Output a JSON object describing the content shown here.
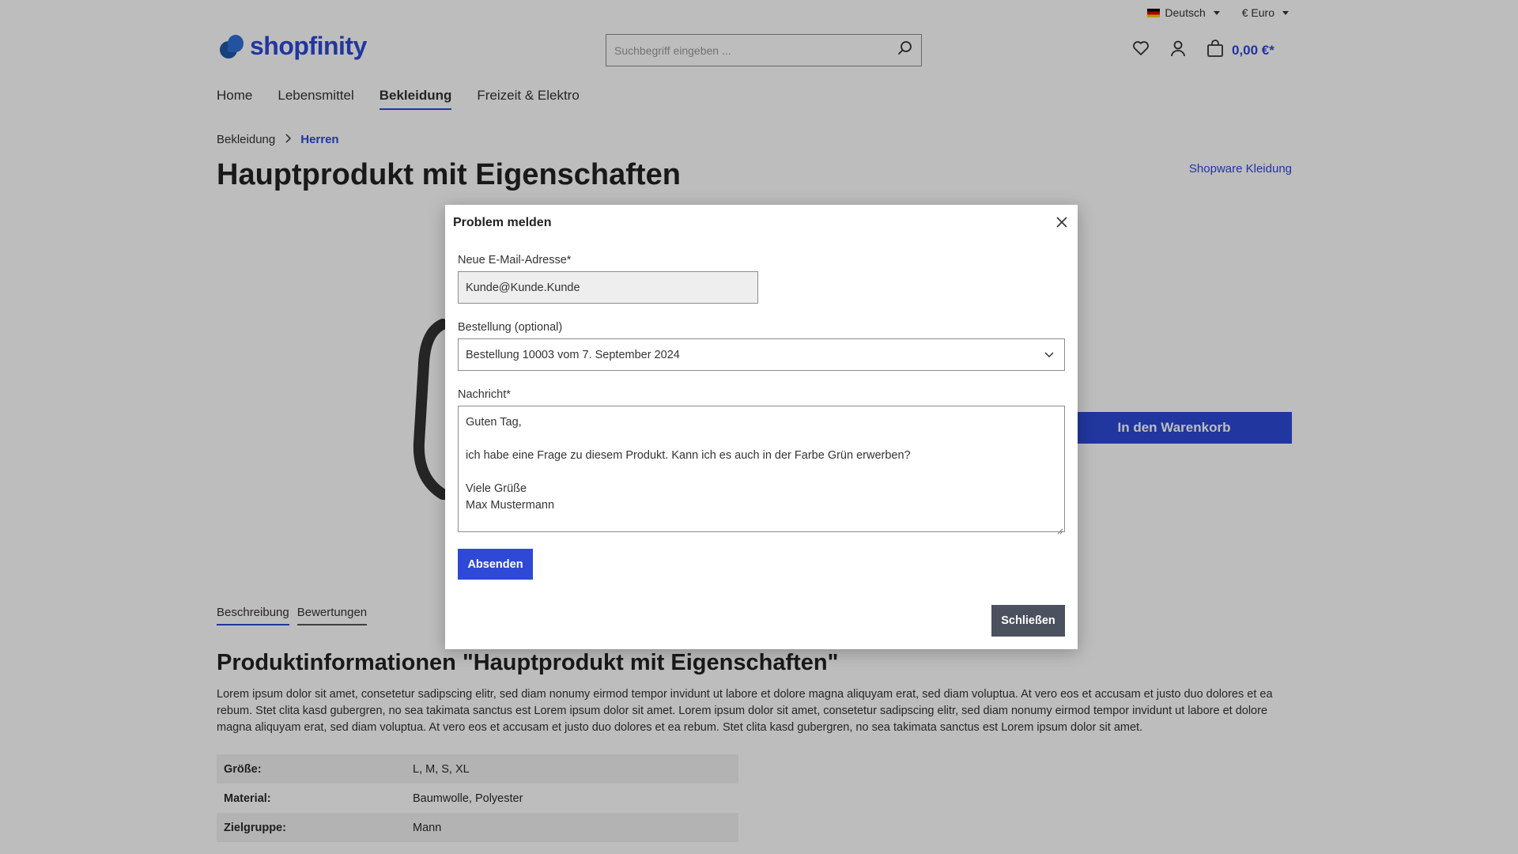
{
  "topbar": {
    "language": "Deutsch",
    "currency": "€ Euro"
  },
  "header": {
    "logo_text": "shopfinity",
    "search_placeholder": "Suchbegriff eingeben ...",
    "cart_total": "0,00 €*"
  },
  "nav": {
    "items": [
      {
        "label": "Home"
      },
      {
        "label": "Lebensmittel"
      },
      {
        "label": "Bekleidung"
      },
      {
        "label": "Freizeit & Elektro"
      }
    ]
  },
  "breadcrumb": {
    "parent": "Bekleidung",
    "current": "Herren"
  },
  "product": {
    "title": "Hauptprodukt mit Eigenschaften",
    "manufacturer": "Shopware Kleidung",
    "buy_label": "In den Warenkorb"
  },
  "tabs": [
    {
      "label": "Beschreibung"
    },
    {
      "label": "Bewertungen"
    }
  ],
  "info": {
    "title": "Produktinformationen \"Hauptprodukt mit Eigenschaften\"",
    "text": "Lorem ipsum dolor sit amet, consetetur sadipscing elitr, sed diam nonumy eirmod tempor invidunt ut labore et dolore magna aliquyam erat, sed diam voluptua. At vero eos et accusam et justo duo dolores et ea rebum. Stet clita kasd gubergren, no sea takimata sanctus est Lorem ipsum dolor sit amet. Lorem ipsum dolor sit amet, consetetur sadipscing elitr, sed diam nonumy eirmod tempor invidunt ut labore et dolore magna aliquyam erat, sed diam voluptua. At vero eos et accusam et justo duo dolores et ea rebum. Stet clita kasd gubergren, no sea takimata sanctus est Lorem ipsum dolor sit amet."
  },
  "properties": [
    {
      "key": "Größe:",
      "value": "L, M, S, XL"
    },
    {
      "key": "Material:",
      "value": "Baumwolle, Polyester"
    },
    {
      "key": "Zielgruppe:",
      "value": "Mann"
    }
  ],
  "modal": {
    "title": "Problem melden",
    "email_label": "Neue E-Mail-Adresse*",
    "email_value": "Kunde@Kunde.Kunde",
    "order_label": "Bestellung (optional)",
    "order_value": "Bestellung 10003 vom 7. September 2024",
    "message_label": "Nachricht*",
    "message_value": "Guten Tag,\n\nich habe eine Frage zu diesem Produkt. Kann ich es auch in der Farbe Grün erwerben?\n\nViele Grüße\nMax Mustermann",
    "submit_label": "Absenden",
    "close_label": "Schließen"
  },
  "colors": {
    "accent": "#2d49d6",
    "close_button": "#4b515e"
  }
}
